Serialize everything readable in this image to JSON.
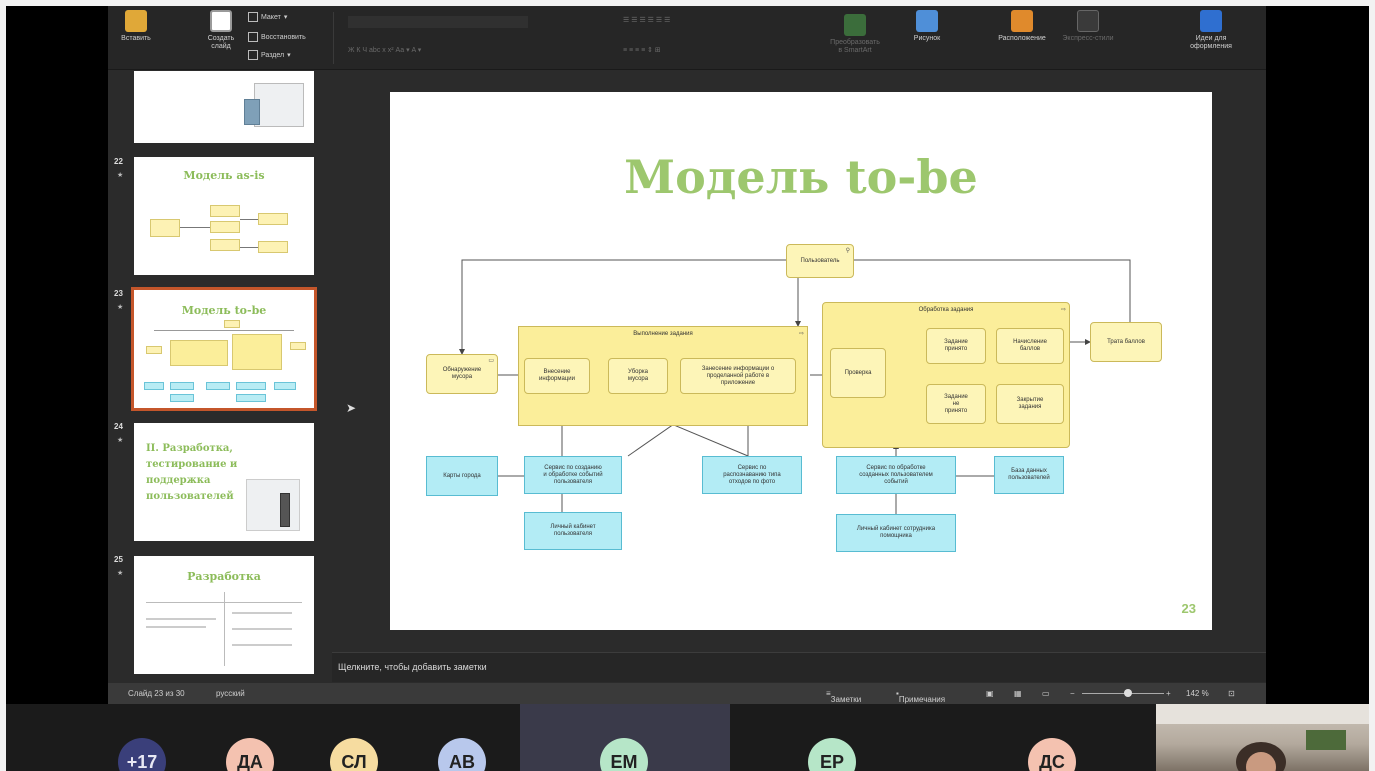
{
  "ribbon": {
    "paste_label": "Вставить",
    "new_slide_label": "Создать\nслайд",
    "layout_label": "Макет",
    "reset_label": "Восстановить",
    "section_label": "Раздел",
    "smartart_label": "Преобразовать\nв SmartArt",
    "picture_label": "Рисунок",
    "arrange_label": "Расположение",
    "quick_styles_label": "Экспресс-стили",
    "designer_label": "Идеи для\nоформления"
  },
  "thumbnails": [
    {
      "number": "",
      "title": ""
    },
    {
      "number": "22",
      "title": "Модель as-is"
    },
    {
      "number": "23",
      "title": "Модель to-be"
    },
    {
      "number": "24",
      "title": "II. Разработка,\nтестирование и\nподдержка\nпользователей"
    },
    {
      "number": "25",
      "title": "Разработка"
    }
  ],
  "slide": {
    "title": "Модель to-be",
    "number": "23",
    "diagram": {
      "user": "Пользователь",
      "discover": "Обнаружение\nмусора",
      "group_execute": "Выполнение задания",
      "enter_info": "Внесение\nинформации",
      "cleanup": "Уборка\nмусора",
      "record_info": "Занесение информации о\nпроделанной работе в\nприложение",
      "group_process": "Обработка задания",
      "check": "Проверка",
      "accepted": "Задание\nпринято",
      "not_accepted": "Задание\nне\nпринято",
      "points_award": "Начисление\nбаллов",
      "close_task": "Закрытие\nзадания",
      "spend_points": "Трата баллов",
      "city_map": "Карты города",
      "service_events": "Сервис по созданию\nи обработке событий\nпользователя",
      "service_photo": "Сервис по\nраспознаванию типа\nотходов по фото",
      "service_staff": "Сервис по обработке\nсозданных пользователем\nсобытий",
      "user_db": "База данных\nпользователей",
      "user_cabinet": "Личный кабинет\nпользователя",
      "staff_cabinet": "Личный кабинет сотрудника\nпомощника"
    }
  },
  "notes": {
    "placeholder": "Щелкните, чтобы добавить заметки"
  },
  "status": {
    "slide_info": "Слайд 23 из 30",
    "language": "русский",
    "notes_label": "Заметки",
    "comments_label": "Примечания",
    "zoom": "142 %"
  },
  "participants": [
    {
      "initials": "+17",
      "color": "#3a3f7a"
    },
    {
      "initials": "ДА",
      "color": "#f4c2b0"
    },
    {
      "initials": "СЛ",
      "color": "#f6dca0"
    },
    {
      "initials": "АВ",
      "color": "#b8c8ec"
    },
    {
      "initials": "ЕМ",
      "color": "#b6e6c8"
    },
    {
      "initials": "ЕР",
      "color": "#b6e6c8"
    },
    {
      "initials": "ДС",
      "color": "#f4c2b0"
    }
  ]
}
